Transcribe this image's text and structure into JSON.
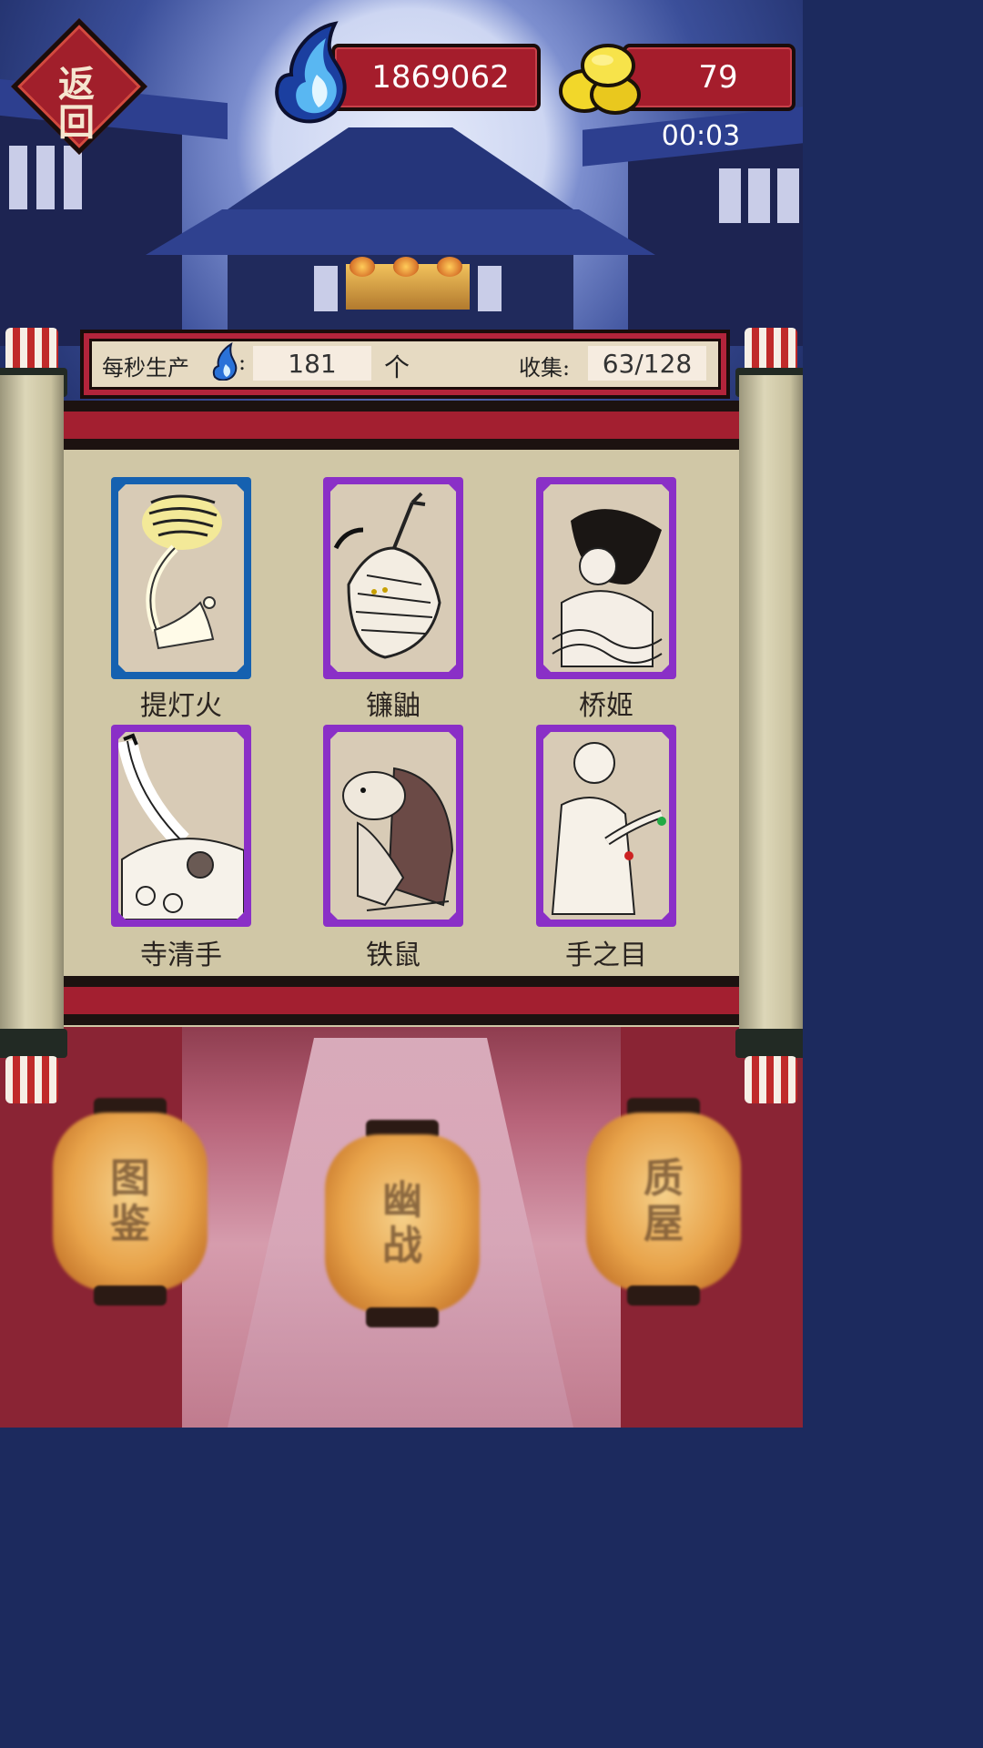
{
  "header": {
    "back_label": "返回",
    "spirit_fire": "1869062",
    "gold": "79",
    "timer": "00:03"
  },
  "production": {
    "per_second_label": "每秒生产",
    "colon": ":",
    "per_second_value": "181",
    "unit": "个",
    "collect_label": "收集:",
    "collect_value": "63/128"
  },
  "cards": [
    {
      "name": "提灯火",
      "rarity_color": "#1561b0"
    },
    {
      "name": "镰鼬",
      "rarity_color": "#8a2fc7"
    },
    {
      "name": "桥姬",
      "rarity_color": "#8a2fc7"
    },
    {
      "name": "寺清手",
      "rarity_color": "#8a2fc7"
    },
    {
      "name": "铁鼠",
      "rarity_color": "#8a2fc7"
    },
    {
      "name": "手之目",
      "rarity_color": "#8a2fc7"
    }
  ],
  "lanterns": [
    {
      "label": "图鉴"
    },
    {
      "label": "幽战"
    },
    {
      "label": "质屋"
    }
  ],
  "icons": {
    "back": "back-diamond-icon",
    "spirit_fire": "blue-flame-icon",
    "gold": "gold-coins-icon"
  }
}
